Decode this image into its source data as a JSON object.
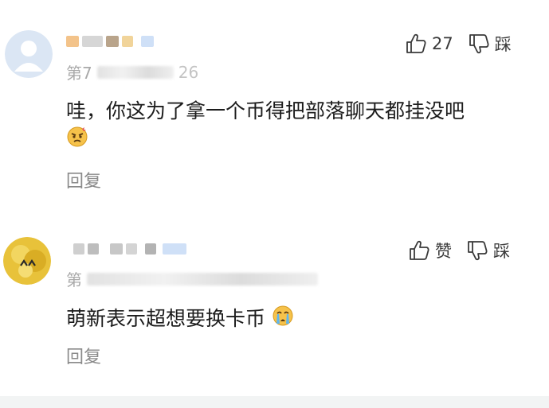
{
  "comments": [
    {
      "floor_prefix": "第7",
      "floor_suffix": "26",
      "text": "哇，你这为了拿一个币得把部落聊天都挂没吧",
      "like_label": "27",
      "dislike_label": "踩",
      "reply_label": "回复",
      "emoji": "angry-face"
    },
    {
      "floor_prefix": "第",
      "text": "萌新表示超想要换卡币",
      "like_label": "赞",
      "dislike_label": "踩",
      "reply_label": "回复",
      "emoji": "crying-face"
    }
  ],
  "icons": {
    "like": "thumbs-up-icon",
    "dislike": "thumbs-down-icon"
  },
  "colors": {
    "text": "#1c1c1c",
    "muted": "#8a8a8a",
    "avatar_default": "#dbe6f4"
  }
}
